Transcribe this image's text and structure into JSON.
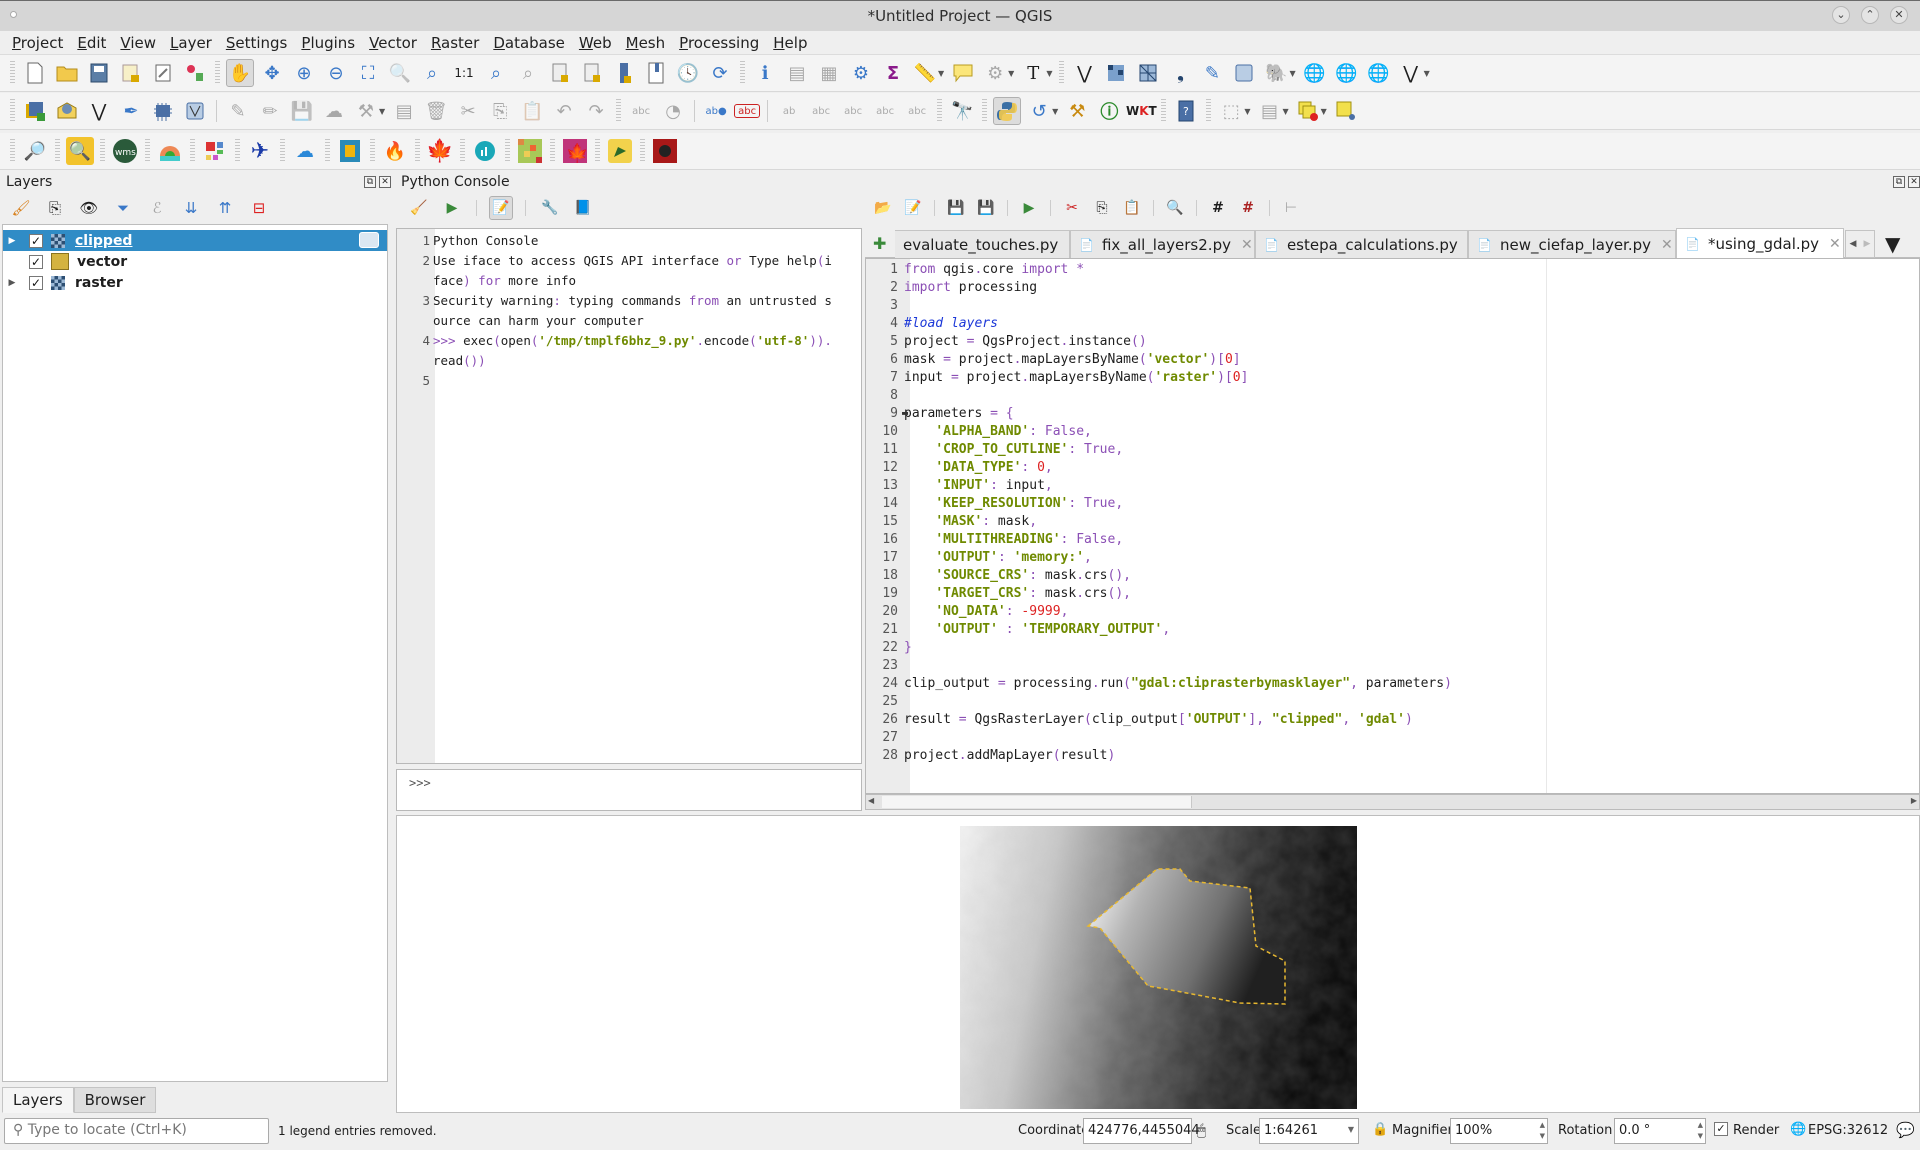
{
  "window": {
    "title": "*Untitled Project — QGIS",
    "controls": [
      "minimize",
      "maximize",
      "close"
    ]
  },
  "menubar": [
    "Project",
    "Edit",
    "View",
    "Layer",
    "Settings",
    "Plugins",
    "Vector",
    "Raster",
    "Database",
    "Web",
    "Mesh",
    "Processing",
    "Help"
  ],
  "toolbars": {
    "row1": [
      "new-project",
      "open-project",
      "save-project",
      "save-as",
      "print-layout",
      "style-manager",
      "pan",
      "pan-to-selection",
      "zoom-in",
      "zoom-out",
      "zoom-full",
      "zoom-to-selection",
      "zoom-to-layer",
      "zoom-native",
      "zoom-last",
      "zoom-next",
      "new-bookmark",
      "show-bookmarks",
      "temporal-controller",
      "refresh",
      "identify",
      "attribute-table",
      "field-calculator",
      "processing-toolbox",
      "statistics",
      "measure",
      "map-tips",
      "annotation",
      "text-annotation",
      "new-shapefile",
      "new-geopackage",
      "new-mesh",
      "new-spatialite",
      "new-scratch-layer",
      "virtual-layer",
      "add-postgis",
      "add-wms",
      "add-wfs",
      "add-wcs",
      "new-vector"
    ],
    "row2": [
      "add-layer",
      "add-vector",
      "digitize",
      "capture-line",
      "add-raster",
      "current-edits",
      "toggle-editing",
      "save-edits",
      "add-feature",
      "vertex-tool",
      "modify-attributes",
      "delete-selected",
      "cut",
      "copy",
      "paste",
      "undo",
      "redo",
      "label",
      "layer-diagram",
      "highlight-pinned",
      "pin-labels",
      "show-hide-labels",
      "move-label",
      "rotate-label",
      "change-label",
      "change-label-props",
      "quickmapservices",
      "python-console",
      "reload-plugin",
      "plugin-builder",
      "identify-plus",
      "wkt",
      "help",
      "select-features",
      "select-by-expression",
      "deselect",
      "select-location"
    ],
    "row3": [
      "geo-search",
      "search",
      "wms",
      "color-ramp",
      "tiles",
      "flight",
      "weather",
      "square",
      "fire",
      "maple",
      "chart",
      "heatmap",
      "maple-alt",
      "plugin-green",
      "plugin-red"
    ]
  },
  "layers_panel": {
    "title": "Layers",
    "layers": [
      {
        "name": "clipped",
        "checked": true,
        "type": "raster",
        "selected": true,
        "expandable": true
      },
      {
        "name": "vector",
        "checked": true,
        "type": "vector",
        "selected": false,
        "expandable": false
      },
      {
        "name": "raster",
        "checked": true,
        "type": "raster",
        "selected": false,
        "expandable": true
      }
    ],
    "tabs": [
      "Layers",
      "Browser"
    ],
    "active_tab": "Layers"
  },
  "python_console": {
    "title": "Python Console",
    "output_lines": [
      {
        "n": "1",
        "text": "Python Console"
      },
      {
        "n": "2",
        "text": "Use iface to access QGIS API interface or Type help(i"
      },
      {
        "n": "",
        "text": "face) for more info"
      },
      {
        "n": "3",
        "text": "Security warning: typing commands from an untrusted s"
      },
      {
        "n": "",
        "text": "ource can harm your computer"
      },
      {
        "n": "4",
        "text": ">>> exec(open('/tmp/tmplf6bhz_9.py'.encode('utf-8'))."
      },
      {
        "n": "",
        "text": "read())"
      },
      {
        "n": "5",
        "text": ""
      }
    ],
    "prompt": ">>>"
  },
  "editor": {
    "tabs": [
      {
        "label": "evaluate_touches.py",
        "active": false
      },
      {
        "label": "fix_all_layers2.py",
        "active": false
      },
      {
        "label": "estepa_calculations.py",
        "active": false
      },
      {
        "label": "new_ciefap_layer.py",
        "active": false
      },
      {
        "label": "*using_gdal.py",
        "active": true
      }
    ],
    "code_lines": [
      "from qgis.core import *",
      "import processing",
      "",
      "#load layers",
      "project = QgsProject.instance()",
      "mask = project.mapLayersByName('vector')[0]",
      "input = project.mapLayersByName('raster')[0]",
      "",
      "parameters = {",
      "    'ALPHA_BAND': False,",
      "    'CROP_TO_CUTLINE': True,",
      "    'DATA_TYPE': 0,",
      "    'INPUT': input,",
      "    'KEEP_RESOLUTION': True,",
      "    'MASK': mask,",
      "    'MULTITHREADING': False,",
      "    'OUTPUT': 'memory:',",
      "    'SOURCE_CRS': mask.crs(),",
      "    'TARGET_CRS': mask.crs(),",
      "    'NO_DATA': -9999,",
      "    'OUTPUT' : 'TEMPORARY_OUTPUT',",
      "}",
      "",
      "clip_output = processing.run(\"gdal:cliprasterbymasklayer\", parameters)",
      "",
      "result = QgsRasterLayer(clip_output['OUTPUT'], \"clipped\", 'gdal')",
      "",
      "project.addMapLayer(result)"
    ]
  },
  "statusbar": {
    "locator_placeholder": "Type to locate (Ctrl+K)",
    "message": "1 legend entries removed.",
    "coordinate_label": "Coordinate",
    "coordinate": "424776,4455044",
    "scale_label": "Scale",
    "scale": "1:64261",
    "magnifier_label": "Magnifier",
    "magnifier": "100%",
    "rotation_label": "Rotation",
    "rotation": "0.0 °",
    "render_label": "Render",
    "render_checked": true,
    "crs": "EPSG:32612"
  },
  "colors": {
    "selection": "#308cc6",
    "vector_fill": "#d4b340",
    "string": "#6f8a00",
    "keyword": "#8b4fb5",
    "number": "#dd2222",
    "comment": "#1c38d8"
  }
}
